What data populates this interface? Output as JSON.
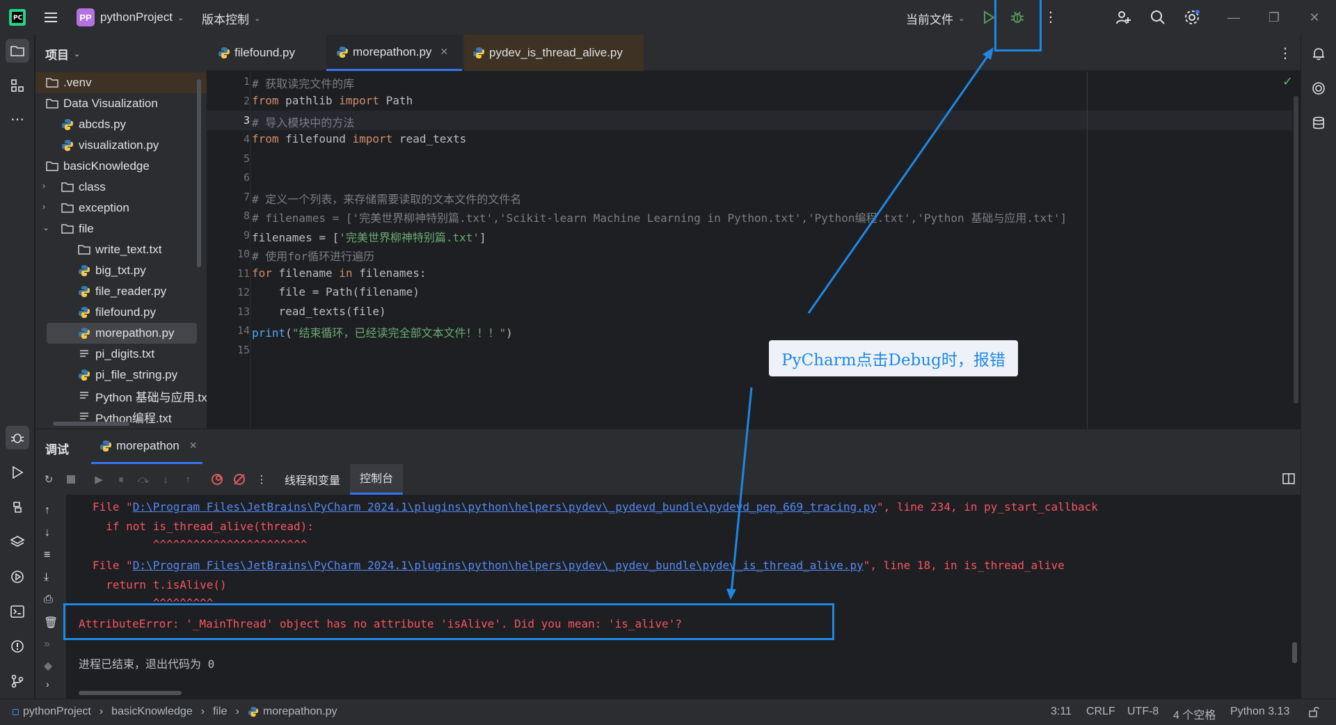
{
  "titlebar": {
    "project_badge": "PP",
    "project_name": "pythonProject",
    "vcs_menu": "版本控制",
    "run_config": "当前文件"
  },
  "project_panel": {
    "title": "项目",
    "items": [
      {
        "label": ".venv",
        "icon": "folder-icon"
      },
      {
        "label": "Data Visualization",
        "icon": "folder-icon"
      },
      {
        "label": "abcds.py",
        "icon": "python-file-icon"
      },
      {
        "label": "visualization.py",
        "icon": "python-file-icon"
      },
      {
        "label": "basicKnowledge",
        "icon": "folder-icon"
      },
      {
        "label": "class",
        "icon": "folder-icon"
      },
      {
        "label": "exception",
        "icon": "folder-icon"
      },
      {
        "label": "file",
        "icon": "folder-icon"
      },
      {
        "label": "write_text.txt",
        "icon": "folder-icon"
      },
      {
        "label": "big_txt.py",
        "icon": "python-file-icon"
      },
      {
        "label": "file_reader.py",
        "icon": "python-file-icon"
      },
      {
        "label": "filefound.py",
        "icon": "python-file-icon"
      },
      {
        "label": "morepathon.py",
        "icon": "python-file-icon"
      },
      {
        "label": "pi_digits.txt",
        "icon": "text-file-icon"
      },
      {
        "label": "pi_file_string.py",
        "icon": "python-file-icon"
      },
      {
        "label": "Python 基础与应用.txt",
        "icon": "text-file-icon"
      },
      {
        "label": "Python编程.txt",
        "icon": "text-file-icon"
      }
    ]
  },
  "editor": {
    "tabs": [
      {
        "label": "filefound.py"
      },
      {
        "label": "morepathon.py"
      },
      {
        "label": "pydev_is_thread_alive.py"
      }
    ],
    "line_numbers": [
      "1",
      "2",
      "3",
      "4",
      "5",
      "6",
      "7",
      "8",
      "9",
      "10",
      "11",
      "12",
      "13",
      "14",
      "15"
    ],
    "code": {
      "l1": "# 获取读完文件的库",
      "l2_kw1": "from",
      "l2_mid": " pathlib ",
      "l2_kw2": "import",
      "l2_end": " Path",
      "l3": "# 导入模块中的方法",
      "l4_kw1": "from",
      "l4_mid": " filefound ",
      "l4_kw2": "import",
      "l4_end": " read_texts",
      "l7": "# 定义一个列表，来存储需要读取的文本文件的文件名",
      "l8": "# filenames = ['完美世界柳神特别篇.txt','Scikit-learn Machine Learning in Python.txt','Python编程.txt','Python 基础与应用.txt']",
      "l9_a": "filenames = [",
      "l9_str": "'完美世界柳神特别篇.txt'",
      "l9_b": "]",
      "l10": "# 使用for循环进行遍历",
      "l11_kw1": "for",
      "l11_mid": " filename ",
      "l11_kw2": "in",
      "l11_end": " filenames:",
      "l12": "    file = Path(filename)",
      "l13": "    read_texts(file)",
      "l14_fn": "print",
      "l14_a": "(",
      "l14_str": "\"结束循环，已经读完全部文本文件！！！\"",
      "l14_b": ")"
    }
  },
  "debug_panel": {
    "title": "调试",
    "session_tab": "morepathon",
    "sub_tabs": [
      "线程和变量",
      "控制台"
    ],
    "console": {
      "l1_prefix": "File \"",
      "l1_link": "D:\\Program Files\\JetBrains\\PyCharm 2024.1\\plugins\\python\\helpers\\pydev\\_pydevd_bundle\\pydevd_pep_669_tracing.py",
      "l1_suffix": "\", line 234, in py_start_callback",
      "l2": "  if not is_thread_alive(thread):",
      "l3": "         ^^^^^^^^^^^^^^^^^^^^^^^",
      "l4_prefix": "File \"",
      "l4_link": "D:\\Program Files\\JetBrains\\PyCharm 2024.1\\plugins\\python\\helpers\\pydev\\_pydev_bundle\\pydev_is_thread_alive.py",
      "l4_suffix": "\", line 18, in is_thread_alive",
      "l5": "  return t.isAlive()",
      "l6": "         ^^^^^^^^^",
      "l7": "AttributeError: '_MainThread' object has no attribute 'isAlive'. Did you mean: 'is_alive'?",
      "l8": "进程已结束，退出代码为 0"
    }
  },
  "statusbar": {
    "breadcrumb": [
      "pythonProject",
      "basicKnowledge",
      "file",
      "morepathon.py"
    ],
    "position": "3:11",
    "line_sep": "CRLF",
    "encoding": "UTF-8",
    "indent": "4 个空格",
    "interpreter": "Python 3.13"
  },
  "annotation": {
    "callout": "PyCharm点击Debug时，报错",
    "color": "#1e88e5"
  }
}
